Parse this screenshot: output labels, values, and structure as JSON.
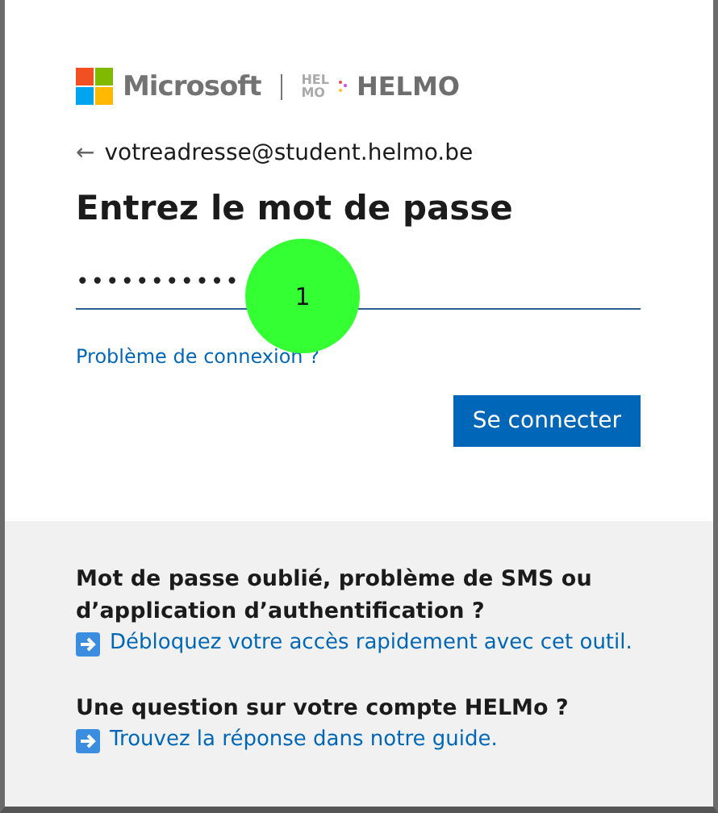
{
  "brand": {
    "company": "Microsoft",
    "school_mark_top": "HEL",
    "school_mark_bottom": "MO",
    "school": "HELMO"
  },
  "account": {
    "back": "←",
    "email": "votreadresse@student.helmo.be"
  },
  "title": "Entrez le mot de passe",
  "password": {
    "value": "•••••••••••"
  },
  "annotation": {
    "label": "1"
  },
  "trouble_link": "Problème de connexion ?",
  "submit": "Se connecter",
  "help": [
    {
      "question": "Mot de passe oublié, problème de SMS ou d’application d’authentification ?",
      "link": "Débloquez votre accès rapidement avec cet outil."
    },
    {
      "question": "Une question sur votre compte HELMo ?",
      "link": "Trouvez la réponse dans notre guide."
    }
  ]
}
